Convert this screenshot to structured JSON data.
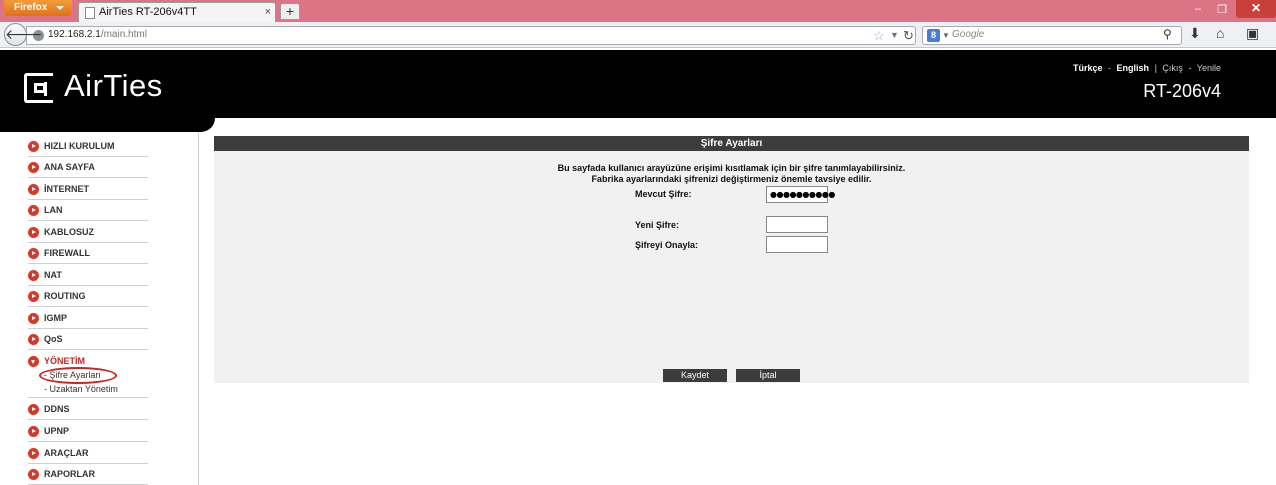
{
  "browser": {
    "menu_button": "Firefox",
    "tab_title": "AirTies RT-206v4TT",
    "tab_close": "×",
    "new_tab": "+",
    "url_host": "192.168.2.1",
    "url_path": "/main.html",
    "search_engine_icon": "8",
    "search_placeholder": "Google",
    "win_min": "–",
    "win_restore": "❐",
    "win_close": "✕"
  },
  "header": {
    "logo_text": "AirTies",
    "lang_tr": "Türkçe",
    "lang_sep": "-",
    "lang_en": "English",
    "pipe": "|",
    "exit": "Çıkış",
    "refresh": "Yenile",
    "model": "RT-206v4"
  },
  "sidebar": {
    "items": [
      {
        "label": "HIZLI KURULUM"
      },
      {
        "label": "ANA SAYFA"
      },
      {
        "label": "İNTERNET"
      },
      {
        "label": "LAN"
      },
      {
        "label": "KABLOSUZ"
      },
      {
        "label": "FIREWALL"
      },
      {
        "label": "NAT"
      },
      {
        "label": "ROUTING"
      },
      {
        "label": "IGMP"
      },
      {
        "label": "QoS"
      },
      {
        "label": "YÖNETİM"
      },
      {
        "label": "DDNS"
      },
      {
        "label": "UPNP"
      },
      {
        "label": "ARAÇLAR"
      },
      {
        "label": "RAPORLAR"
      }
    ],
    "subitems": [
      {
        "label": "- Şifre Ayarları"
      },
      {
        "label": "- Uzaktan Yönetim"
      }
    ]
  },
  "panel": {
    "title": "Şifre Ayarları",
    "desc_line1": "Bu sayfada kullanıcı arayüzüne erişimi kısıtlamak için bir şifre tanımlayabilirsiniz.",
    "desc_line2": "Fabrika ayarlarındaki şifrenizi değiştirmeniz önemle tavsiye edilir.",
    "current_label": "Mevcut Şifre:",
    "current_value": "●●●●●●●●●●",
    "new_label": "Yeni Şifre:",
    "new_value": "",
    "confirm_label": "Şifreyi Onayla:",
    "confirm_value": "",
    "save_button": "Kaydet",
    "cancel_button": "İptal"
  }
}
